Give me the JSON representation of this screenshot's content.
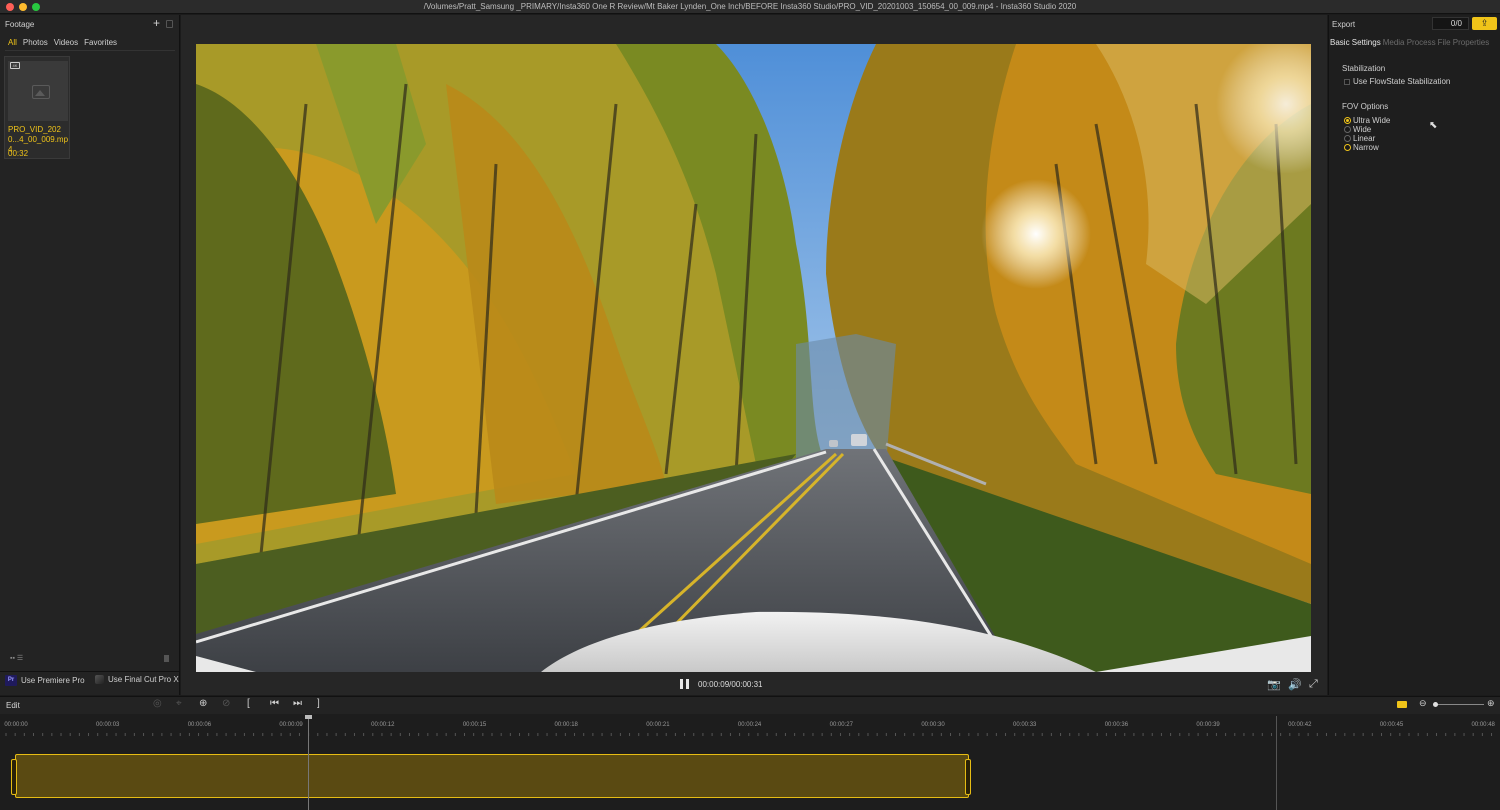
{
  "window": {
    "title": "/Volumes/Pratt_Samsung _PRIMARY/Insta360 One R Review/Mt Baker Lynden_One Inch/BEFORE Insta360 Studio/PRO_VID_20201003_150654_00_009.mp4 - Insta360 Studio 2020"
  },
  "footage": {
    "header": "Footage",
    "tabs": [
      "All",
      "Photos",
      "Videos",
      "Favorites"
    ],
    "active_tab": "All",
    "clip": {
      "name": "PRO_VID_2020...4_00_009.mp4",
      "duration": "00:32"
    },
    "plugins": [
      "Use Premiere Pro",
      "Use Final Cut Pro X"
    ],
    "pr_badge": "Pr"
  },
  "player": {
    "timecode": "00:00:09/00:00:31"
  },
  "export": {
    "label": "Export",
    "count": "0/0",
    "tabs": [
      "Basic Settings",
      "Media Process",
      "File Properties"
    ],
    "active_tab": "Basic Settings",
    "stabilization": {
      "label": "Stabilization",
      "option": "Use FlowState Stabilization",
      "checked": false
    },
    "fov": {
      "label": "FOV Options",
      "options": [
        "Ultra Wide",
        "Wide",
        "Linear",
        "Narrow"
      ],
      "selected": "Ultra Wide"
    }
  },
  "edit": {
    "label": "Edit"
  },
  "timeline": {
    "ticks": [
      "00:00:00",
      "00:00:03",
      "00:00:06",
      "00:00:09",
      "00:00:12",
      "00:00:15",
      "00:00:18",
      "00:00:21",
      "00:00:24",
      "00:00:27",
      "00:00:30",
      "00:00:33",
      "00:00:36",
      "00:00:39",
      "00:00:42",
      "00:00:45",
      "00:00:48"
    ],
    "playhead": "00:00:09",
    "clip_start": "00:00:00",
    "clip_end": "00:00:31"
  },
  "colors": {
    "accent": "#f0c419",
    "panel": "#232323",
    "clip_fill": "#5a4a12"
  }
}
